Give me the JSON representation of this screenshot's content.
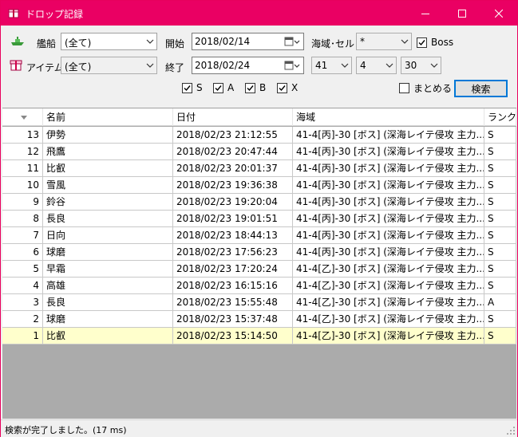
{
  "window": {
    "title": "ドロップ記録"
  },
  "filters": {
    "ship_label": "艦船",
    "ship_value": "(全て)",
    "item_label": "アイテム",
    "item_value": "(全て)",
    "start_label": "開始",
    "start_date": "2018/02/14",
    "end_label": "終了",
    "end_date": "2018/02/24",
    "area_label": "海域･セル",
    "area_value": "*",
    "boss_label": "Boss",
    "boss_checked": true,
    "world_value": "41",
    "map_value": "4",
    "cell_value": "30",
    "rank_s_label": "S",
    "rank_a_label": "A",
    "rank_b_label": "B",
    "rank_x_label": "X",
    "merge_label": "まとめる",
    "merge_checked": false,
    "search_button": "検索"
  },
  "table": {
    "columns": [
      "",
      "名前",
      "日付",
      "海域",
      "ランク"
    ],
    "rows": [
      {
        "no": "13",
        "name": "伊勢",
        "date": "2018/02/23 21:12:55",
        "area": "41-4[丙]-30 [ボス] (深海レイテ侵攻 主力...",
        "rank": "S"
      },
      {
        "no": "12",
        "name": "飛鷹",
        "date": "2018/02/23 20:47:44",
        "area": "41-4[丙]-30 [ボス] (深海レイテ侵攻 主力...",
        "rank": "S"
      },
      {
        "no": "11",
        "name": "比叡",
        "date": "2018/02/23 20:01:37",
        "area": "41-4[丙]-30 [ボス] (深海レイテ侵攻 主力...",
        "rank": "S"
      },
      {
        "no": "10",
        "name": "雪風",
        "date": "2018/02/23 19:36:38",
        "area": "41-4[丙]-30 [ボス] (深海レイテ侵攻 主力...",
        "rank": "S"
      },
      {
        "no": "9",
        "name": "鈴谷",
        "date": "2018/02/23 19:20:04",
        "area": "41-4[丙]-30 [ボス] (深海レイテ侵攻 主力...",
        "rank": "S"
      },
      {
        "no": "8",
        "name": "長良",
        "date": "2018/02/23 19:01:51",
        "area": "41-4[丙]-30 [ボス] (深海レイテ侵攻 主力...",
        "rank": "S"
      },
      {
        "no": "7",
        "name": "日向",
        "date": "2018/02/23 18:44:13",
        "area": "41-4[丙]-30 [ボス] (深海レイテ侵攻 主力...",
        "rank": "S"
      },
      {
        "no": "6",
        "name": "球磨",
        "date": "2018/02/23 17:56:23",
        "area": "41-4[丙]-30 [ボス] (深海レイテ侵攻 主力...",
        "rank": "S"
      },
      {
        "no": "5",
        "name": "早霜",
        "date": "2018/02/23 17:20:24",
        "area": "41-4[乙]-30 [ボス] (深海レイテ侵攻 主力...",
        "rank": "S"
      },
      {
        "no": "4",
        "name": "高雄",
        "date": "2018/02/23 16:15:16",
        "area": "41-4[乙]-30 [ボス] (深海レイテ侵攻 主力...",
        "rank": "S"
      },
      {
        "no": "3",
        "name": "長良",
        "date": "2018/02/23 15:55:48",
        "area": "41-4[乙]-30 [ボス] (深海レイテ侵攻 主力...",
        "rank": "A"
      },
      {
        "no": "2",
        "name": "球磨",
        "date": "2018/02/23 15:37:48",
        "area": "41-4[乙]-30 [ボス] (深海レイテ侵攻 主力...",
        "rank": "S"
      },
      {
        "no": "1",
        "name": "比叡",
        "date": "2018/02/23 15:14:50",
        "area": "41-4[乙]-30 [ボス] (深海レイテ侵攻 主力...",
        "rank": "S"
      }
    ]
  },
  "status": {
    "text": "検索が完了しました。(17 ms)"
  },
  "colors": {
    "titlebar": "#ea0063",
    "selected_row": "#ffffcc",
    "grid_empty": "#ababab",
    "button_border": "#0078d7"
  }
}
